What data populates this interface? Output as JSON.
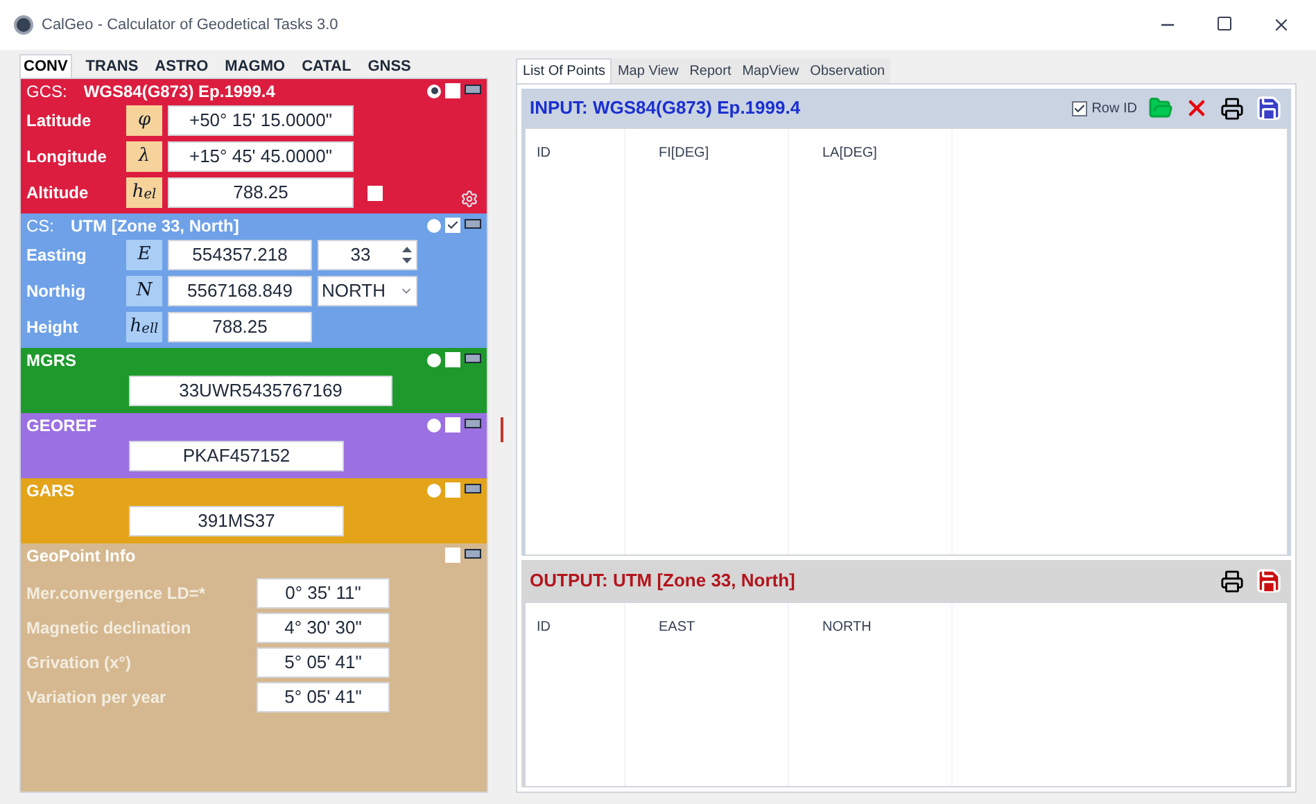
{
  "window": {
    "title": "CalGeo - Calculator of Geodetical Tasks 3.0"
  },
  "left_tabs": [
    {
      "label": "CONV",
      "selected": true
    },
    {
      "label": "TRANS",
      "selected": false
    },
    {
      "label": "ASTRO",
      "selected": false
    },
    {
      "label": "MAGMO",
      "selected": false
    },
    {
      "label": "CATAL",
      "selected": false
    },
    {
      "label": "GNSS",
      "selected": false
    }
  ],
  "sections": [
    {
      "kind": "coords",
      "color": "#dc1d3f",
      "title": "GCS:",
      "subtitle": "WGS84(G873) Ep.1999.4",
      "selected": true,
      "checked": false,
      "rows": [
        {
          "kind": "plain",
          "label": "Latitude",
          "symbol": "φ",
          "value": "+50° 15' 15.0000\""
        },
        {
          "kind": "plain",
          "label": "Longitude",
          "symbol": "λ",
          "value": "+15° 45' 45.0000\""
        },
        {
          "kind": "check",
          "label": "Altitude",
          "symbol": "h$_{el}$",
          "value": "788.25",
          "checked": false
        }
      ]
    },
    {
      "kind": "coords",
      "color": "#6ea1e8",
      "title": "CS:",
      "subtitle": "UTM [Zone 33, North]",
      "selected": false,
      "checked": true,
      "rows": [
        {
          "kind": "spin",
          "label": "Easting",
          "symbol": "E",
          "value": "554357.218",
          "extra": "33"
        },
        {
          "kind": "select",
          "label": "Northig",
          "symbol": "N",
          "value": "5567168.849",
          "extra": "NORTH"
        },
        {
          "kind": "plain",
          "label": "Height",
          "symbol": "h$_{ell}$",
          "value": "788.25"
        }
      ]
    },
    {
      "kind": "code",
      "color": "#1e9a2c",
      "title": "MGRS",
      "selected": false,
      "checked": false,
      "value": "33UWR5435767169"
    },
    {
      "kind": "code",
      "color": "#9b70e2",
      "title": "GEOREF",
      "selected": false,
      "checked": false,
      "value": "PKAF457152"
    },
    {
      "kind": "code",
      "color": "#e3a41a",
      "title": "GARS",
      "selected": false,
      "checked": false,
      "value": "391MS37"
    },
    {
      "kind": "info",
      "color": "#d5b88f",
      "title": "GeoPoint Info",
      "checked": false,
      "rows": [
        {
          "label": "Mer.convergence LD=*",
          "value": "0° 35' 11\""
        },
        {
          "label": "Magnetic declination",
          "value": "4° 30' 30\""
        },
        {
          "label": "Grivation (x°)",
          "value": "5° 05' 41\""
        },
        {
          "label": "Variation per year",
          "value": "5° 05' 41\""
        }
      ]
    }
  ],
  "right_tabs": [
    {
      "label": "List Of Points",
      "selected": true
    },
    {
      "label": "Map View",
      "selected": false
    },
    {
      "label": "Report",
      "selected": false
    },
    {
      "label": "MapView",
      "selected": false
    },
    {
      "label": "Observation",
      "selected": false
    }
  ],
  "input": {
    "title": "INPUT: WGS84(G873) Ep.1999.4",
    "row_id": {
      "label": "Row ID",
      "checked": true
    },
    "columns": [
      "ID",
      "FI[DEG]",
      "LA[DEG]"
    ]
  },
  "output": {
    "title": "OUTPUT: UTM [Zone 33, North]",
    "columns": [
      "ID",
      "EAST",
      "NORTH"
    ]
  }
}
